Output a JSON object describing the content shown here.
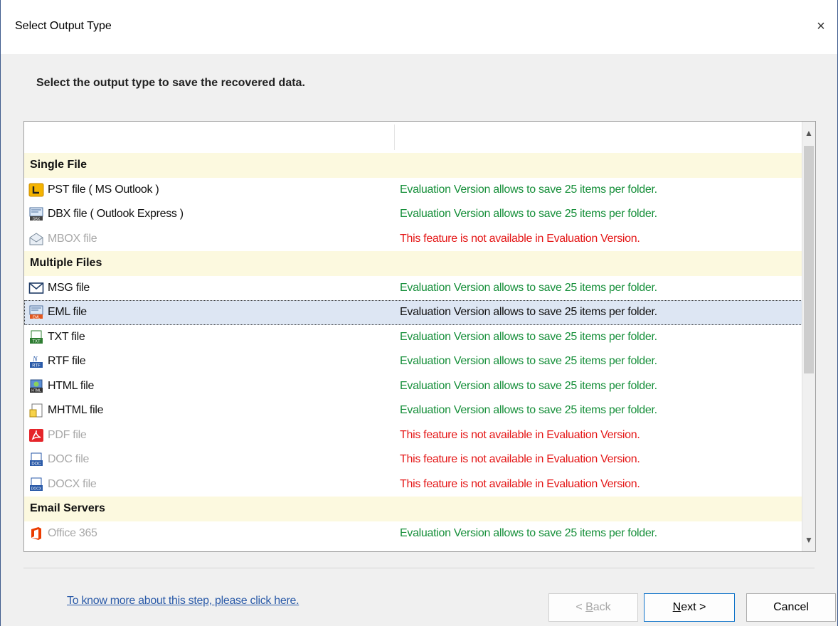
{
  "window": {
    "title": "Select Output Type",
    "close_glyph": "×"
  },
  "instruction": "Select the output type to save the recovered data.",
  "groups": [
    {
      "label": "Single File",
      "items": [
        {
          "icon": "pst-icon",
          "label": "PST file ( MS Outlook )",
          "status": "Evaluation Version allows to save 25 items per folder.",
          "available": true
        },
        {
          "icon": "dbx-icon",
          "label": "DBX file ( Outlook Express )",
          "status": "Evaluation Version allows to save 25 items per folder.",
          "available": true
        },
        {
          "icon": "mbox-icon",
          "label": "MBOX file",
          "status": "This feature is not available in Evaluation Version.",
          "available": false
        }
      ]
    },
    {
      "label": "Multiple Files",
      "items": [
        {
          "icon": "msg-icon",
          "label": "MSG file",
          "status": "Evaluation Version allows to save 25 items per folder.",
          "available": true
        },
        {
          "icon": "eml-icon",
          "label": "EML file",
          "status": "Evaluation Version allows to save 25 items per folder.",
          "available": true,
          "selected": true
        },
        {
          "icon": "txt-icon",
          "label": "TXT file",
          "status": "Evaluation Version allows to save 25 items per folder.",
          "available": true
        },
        {
          "icon": "rtf-icon",
          "label": "RTF file",
          "status": "Evaluation Version allows to save 25 items per folder.",
          "available": true
        },
        {
          "icon": "html-icon",
          "label": "HTML file",
          "status": "Evaluation Version allows to save 25 items per folder.",
          "available": true
        },
        {
          "icon": "mhtml-icon",
          "label": "MHTML file",
          "status": "Evaluation Version allows to save 25 items per folder.",
          "available": true
        },
        {
          "icon": "pdf-icon",
          "label": "PDF file",
          "status": "This feature is not available in Evaluation Version.",
          "available": false
        },
        {
          "icon": "doc-icon",
          "label": "DOC file",
          "status": "This feature is not available in Evaluation Version.",
          "available": false
        },
        {
          "icon": "docx-icon",
          "label": "DOCX file",
          "status": "This feature is not available in Evaluation Version.",
          "available": false
        }
      ]
    },
    {
      "label": "Email Servers",
      "items": [
        {
          "icon": "office365-icon",
          "label": "Office 365",
          "status": "Evaluation Version allows to save 25 items per folder.",
          "available": true,
          "label_greyed": true
        }
      ]
    }
  ],
  "footer": {
    "help_link": "To know more about this step, please click here.",
    "back_label": "< Back",
    "next_label": "Next >",
    "cancel_label": "Cancel"
  },
  "colors": {
    "available": "#168f3a",
    "unavailable": "#e41616",
    "group_bg": "#fcf9df",
    "selected_bg": "#dde6f3"
  }
}
